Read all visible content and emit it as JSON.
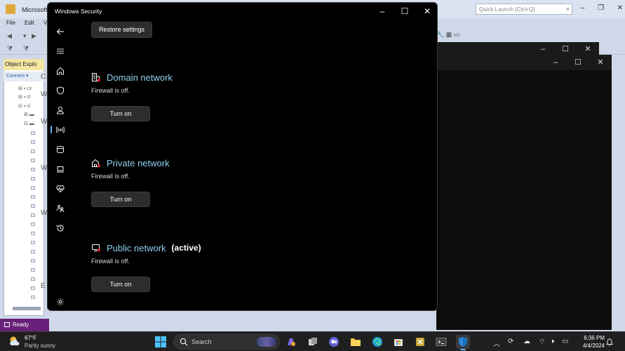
{
  "ssms": {
    "title": "Microsoft",
    "quick_launch_placeholder": "Quick Launch (Ctrl+Q)",
    "menu": [
      "File",
      "Edit",
      "V"
    ],
    "object_explorer_tab": "Object Explo",
    "connect_label": "Connect ▾",
    "status": "Ready",
    "editor_letters": [
      "C",
      "W",
      "W",
      "W",
      "W",
      "E"
    ]
  },
  "windows_security": {
    "title": "Windows Security",
    "restore_button": "Restore settings",
    "networks": [
      {
        "name": "Domain network",
        "active_label": "",
        "status": "Firewall is off.",
        "button": "Turn on"
      },
      {
        "name": "Private network",
        "active_label": "",
        "status": "Firewall is off.",
        "button": "Turn on"
      },
      {
        "name": "Public network",
        "active_label": "(active)",
        "status": "Firewall is off.",
        "button": "Turn on"
      }
    ],
    "nav_icons": [
      "back-arrow-icon",
      "hamburger-menu-icon",
      "home-icon",
      "shield-icon",
      "account-icon",
      "firewall-network-icon",
      "app-browser-icon",
      "device-security-icon",
      "heart-pulse-icon",
      "family-icon",
      "history-icon",
      "settings-gear-icon"
    ],
    "active_nav": "firewall-network-icon"
  },
  "taskbar": {
    "weather_temp": "67°F",
    "weather_desc": "Partly sunny",
    "search_label": "Search",
    "time": "6:36 PM",
    "date": "4/4/2024"
  },
  "colors": {
    "accent": "#5fb2f2",
    "network_name": "#8ed1ef",
    "window_bg": "#000000",
    "button_bg": "#2d2d2d",
    "ssms_status_purple": "#68217a"
  }
}
